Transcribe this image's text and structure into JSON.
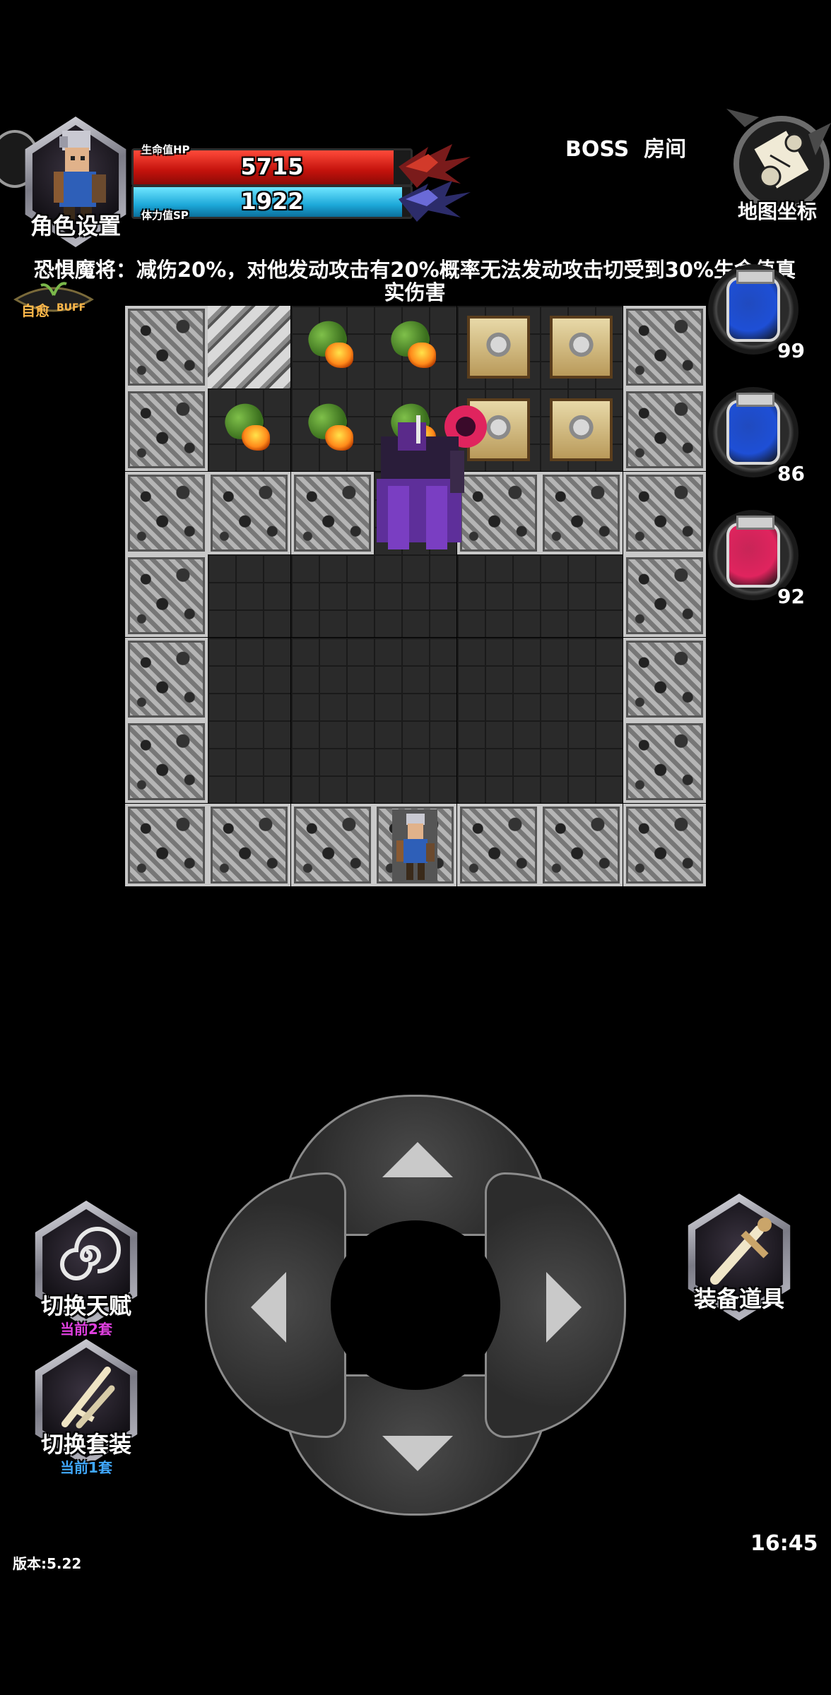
{
  "hud": {
    "character_settings_label": "角色设置",
    "hp_label": "生命值HP",
    "hp_value": "5715",
    "hp_fraction": 0.94,
    "sp_label": "体力值SP",
    "sp_value": "1922",
    "sp_fraction": 0.97,
    "room_label": "BOSS  房间",
    "map_coords_label": "地图坐标",
    "buff_label_main": "自愈",
    "buff_label_sub": "BUFF"
  },
  "boss_info": {
    "description": "恐惧魔将：减伤20%，对他发动攻击有20%概率无法发动攻击切受到30%生命值真实伤害"
  },
  "potions": [
    {
      "name": "blue-potion",
      "count": "99",
      "color": "#1e4fd6"
    },
    {
      "name": "blue-potion",
      "count": "86",
      "color": "#1e4fd6"
    },
    {
      "name": "red-potion",
      "count": "92",
      "color": "#e0245e"
    }
  ],
  "map": {
    "rows": [
      [
        "wall",
        "stairs",
        "plant",
        "plant",
        "chest",
        "chest",
        "wall"
      ],
      [
        "wall",
        "plant",
        "plant",
        "plant",
        "chest",
        "chest",
        "wall"
      ],
      [
        "wall",
        "wall",
        "wall",
        "boss",
        "wall",
        "wall",
        "wall"
      ],
      [
        "wall",
        "floor",
        "floor",
        "floor",
        "floor",
        "floor",
        "wall"
      ],
      [
        "wall",
        "floor",
        "floor",
        "floor",
        "floor",
        "floor",
        "wall"
      ],
      [
        "wall",
        "floor",
        "floor",
        "floor",
        "floor",
        "floor",
        "wall"
      ],
      [
        "wall",
        "wall",
        "wall",
        "hero",
        "wall",
        "wall",
        "wall"
      ]
    ]
  },
  "controls": {
    "talent_switch_label": "切换天赋",
    "talent_current": "当前2套",
    "outfit_switch_label": "切换套装",
    "outfit_current": "当前1套",
    "equip_items_label": "装备道具"
  },
  "footer": {
    "version": "版本:5.22",
    "time": "16:45"
  },
  "colors": {
    "talent_sub": "#e040e0",
    "outfit_sub": "#40a8ff"
  }
}
